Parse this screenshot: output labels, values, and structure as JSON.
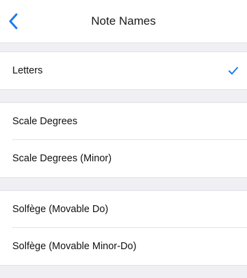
{
  "navbar": {
    "title": "Note Names",
    "back_icon": "chevron-left-icon"
  },
  "colors": {
    "accent": "#1a7bf2",
    "section_bg": "#efeff4",
    "text": "#111111"
  },
  "groups": [
    {
      "items": [
        {
          "label": "Letters",
          "selected": true
        }
      ]
    },
    {
      "items": [
        {
          "label": "Scale Degrees",
          "selected": false
        },
        {
          "label": "Scale Degrees (Minor)",
          "selected": false
        }
      ]
    },
    {
      "items": [
        {
          "label": "Solfège (Movable Do)",
          "selected": false
        },
        {
          "label": "Solfège (Movable Minor-Do)",
          "selected": false
        }
      ]
    }
  ],
  "check_icon": "checkmark-icon"
}
